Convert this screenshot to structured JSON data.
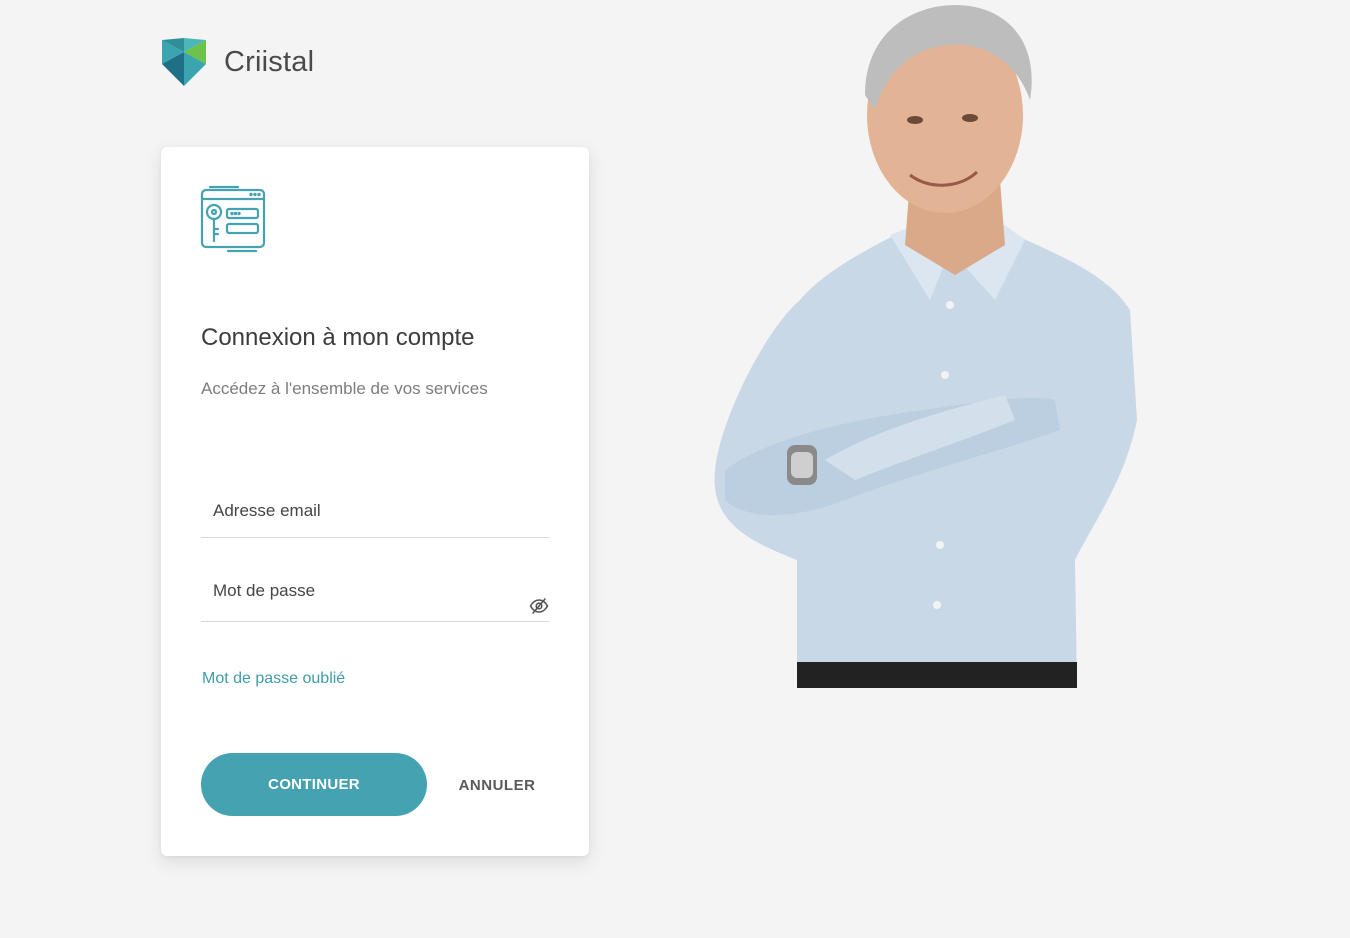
{
  "brand": {
    "name": "Criistal",
    "logo_colors": [
      "#2f8f99",
      "#4cb6b8",
      "#6cc24a",
      "#1f6f86"
    ]
  },
  "login": {
    "icon": "browser-key-icon",
    "title": "Connexion à mon compte",
    "subtitle": "Accédez à l'ensemble de vos services",
    "email_placeholder": "Adresse email",
    "email_value": "",
    "password_placeholder": "Mot de passe",
    "password_value": "",
    "password_toggle_icon": "eye-slash-icon",
    "forgot_link": "Mot de passe oublié",
    "continue_label": "CONTINUER",
    "cancel_label": "ANNULER"
  },
  "hero": {
    "image": "smiling-man-crossed-arms-photo"
  },
  "colors": {
    "accent": "#45a2b0",
    "link": "#3f9ca8",
    "background": "#f4f4f4"
  }
}
